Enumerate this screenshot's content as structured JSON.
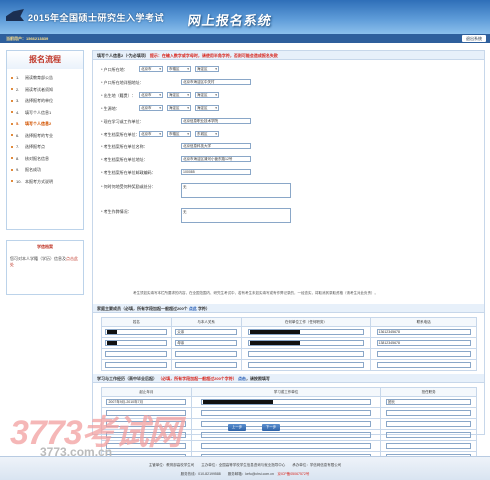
{
  "header": {
    "title": "2015年全国硕士研究生入学考试",
    "system": "网上报名系统",
    "user_label": "当前用户：",
    "user_id": "1566213839",
    "top_right_btn": "退出系统"
  },
  "sidebar": {
    "title": "报名流程",
    "items": [
      {
        "n": "1.",
        "label": "阅读教育部公告"
      },
      {
        "n": "2.",
        "label": "阅读考试者须知"
      },
      {
        "n": "3.",
        "label": "选择报考的单位"
      },
      {
        "n": "4.",
        "label": "填写个人信息1"
      },
      {
        "n": "5.",
        "label": "填写个人信息2"
      },
      {
        "n": "6.",
        "label": "选择报考的专业"
      },
      {
        "n": "7.",
        "label": "选择报考点"
      },
      {
        "n": "8.",
        "label": "核对报名信息"
      },
      {
        "n": "9.",
        "label": "报名成功"
      },
      {
        "n": "10.",
        "label": "本报考方式说明"
      }
    ],
    "current_index": 4,
    "box2_title": "学信档案",
    "box2_text": "您可对本人学籍（学历）信息及",
    "box2_link": "点击此处"
  },
  "main": {
    "section1": "填写个人信息2（*为必填项）",
    "section1_warn": "提示：在输入数字或字母时，请使用半角字符，否则可能会造成报名失败",
    "rows": [
      {
        "label": "* 户口所在地：",
        "sel": [
          "北京市",
          "市辖区",
          "海淀区"
        ]
      },
      {
        "label": "* 户口所在地详细地址：",
        "val": "北京市海淀区中关村"
      },
      {
        "label": "* 出生地（籍贯）：",
        "sel": [
          "北京市",
          "海淀区",
          "海淀区"
        ]
      },
      {
        "label": "* 生源地：",
        "sel": [
          "北京市",
          "海淀区",
          "海淀区"
        ]
      },
      {
        "label": "* 现在学习或工作单位：",
        "val": "北京信息职业技术学院"
      },
      {
        "label": "* 考生档案所在单位：",
        "sel": [
          "北京市",
          "市辖区",
          "东城区"
        ]
      },
      {
        "label": "* 考生档案所在单位名称：",
        "val": "北京信息科技大学"
      },
      {
        "label": "* 考生档案所在单位地址：",
        "val": "北京市海淀区清河小营东路12号"
      },
      {
        "label": "* 考生档案所在单位邮政编码：",
        "val": "100085"
      },
      {
        "label": "* 何时何地受何种奖励或处分：",
        "val": "无"
      },
      {
        "label": "* 考生作弊情况：",
        "val": "无"
      }
    ],
    "note": "考生须如实填写本栏所要求的内容，在全国范围内、研究生考试中，若有考生未如实填写或有作弊记录的，一经查实，将取消其录取资格（请考生对此负责）。",
    "section2": "家庭主要成员（必填，所有字段加起一般超过200个",
    "section2_hint": "字符）",
    "section2_link": "点此",
    "family_headers": [
      "姓名",
      "与本人关系",
      "在何单位工作（任何职务）",
      "联系电话"
    ],
    "family": [
      {
        "rel": "父亲",
        "phone": "13612345678"
      },
      {
        "rel": "母亲",
        "phone": "13812345678"
      },
      {
        "rel": "",
        "phone": ""
      },
      {
        "rel": "",
        "phone": ""
      }
    ],
    "section3": "学习与工作经历（高中毕业后起）",
    "section3_warn": "（必填，所有字段加起一般超过200个字符）",
    "section3_link": "点击",
    "section3_tail": "，请按照填写",
    "edu_headers": [
      "起止年月",
      "学习或工作单位",
      "担任职务"
    ],
    "edu": [
      {
        "period": "2007年9月-2010年7月",
        "role": "团长"
      },
      {
        "period": "",
        "role": ""
      },
      {
        "period": "",
        "role": ""
      },
      {
        "period": "",
        "role": ""
      },
      {
        "period": "",
        "role": ""
      },
      {
        "period": "",
        "role": ""
      }
    ],
    "btn_prev": "上一步",
    "btn_next": "下一步"
  },
  "watermark": {
    "big": "3773考试网",
    "small": "3773.com.cn"
  },
  "footer": {
    "l1": "主管单位：教育部高校学生司　　主办单位：全国高等学校学生信息咨询与就业指导中心　　承办单位：学信网信息有限公司",
    "l2": "服务热线：010-82199588　　服务邮箱：kefu@chsi.com.cn",
    "l2_red": "京ICP备05067572号"
  }
}
